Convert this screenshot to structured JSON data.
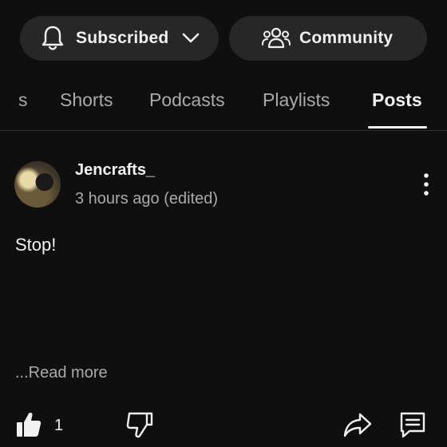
{
  "header": {
    "subscribed_label": "Subscribed",
    "community_label": "Community"
  },
  "tabs": [
    {
      "label": "s",
      "active": false
    },
    {
      "label": "Shorts",
      "active": false
    },
    {
      "label": "Podcasts",
      "active": false
    },
    {
      "label": "Playlists",
      "active": false
    },
    {
      "label": "Posts",
      "active": true
    }
  ],
  "post": {
    "author": "Jencrafts_",
    "time": "3 hours ago (edited)",
    "text": "Stop!",
    "read_more": "...Read more",
    "like_count": "1"
  },
  "icons": {
    "bell": "bell-icon",
    "chevron": "chevron-down-icon",
    "community": "people-icon",
    "more": "more-vert-icon",
    "like": "thumbs-up-filled-icon",
    "dislike": "thumbs-down-icon",
    "share": "share-icon",
    "comment": "comment-icon"
  },
  "colors": {
    "background": "#0f0f0f",
    "pill": "#272727",
    "text": "#f1f1f1",
    "secondary": "#aaaaaa"
  }
}
